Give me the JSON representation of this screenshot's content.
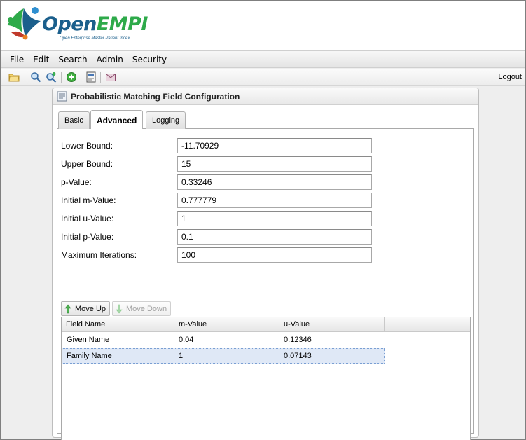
{
  "app": {
    "logo_open": "Open",
    "logo_empi": "EMPI",
    "logo_subtitle": "Open Enterprise Master Patient Index"
  },
  "menu": [
    "File",
    "Edit",
    "Search",
    "Admin",
    "Security"
  ],
  "toolbar": {
    "icons": [
      "open-folder-icon",
      "search-icon",
      "advanced-search-icon",
      "add-icon",
      "report-icon",
      "mail-icon"
    ],
    "logout_label": "Logout"
  },
  "panel": {
    "title": "Probabilistic Matching Field Configuration",
    "tabs": [
      {
        "label": "Basic",
        "active": false
      },
      {
        "label": "Advanced",
        "active": true
      },
      {
        "label": "Logging",
        "active": false
      }
    ]
  },
  "form": {
    "fields": [
      {
        "label": "Lower Bound:",
        "value": "-11.70929"
      },
      {
        "label": "Upper Bound:",
        "value": "15"
      },
      {
        "label": "p-Value:",
        "value": "0.33246"
      },
      {
        "label": "Initial m-Value:",
        "value": "0.777779"
      },
      {
        "label": "Initial u-Value:",
        "value": "1"
      },
      {
        "label": "Initial p-Value:",
        "value": "0.1"
      },
      {
        "label": "Maximum Iterations:",
        "value": "100"
      }
    ]
  },
  "grid": {
    "move_up_label": "Move Up",
    "move_down_label": "Move Down",
    "columns": [
      "Field Name",
      "m-Value",
      "u-Value"
    ],
    "rows": [
      [
        "Given Name",
        "0.04",
        "0.12346"
      ],
      [
        "Family Name",
        "1",
        "0.07143"
      ]
    ]
  },
  "colors": {
    "logo_blue": "#1b5f8c",
    "logo_green": "#2eaa4a",
    "selection": "#dfe8f6"
  }
}
